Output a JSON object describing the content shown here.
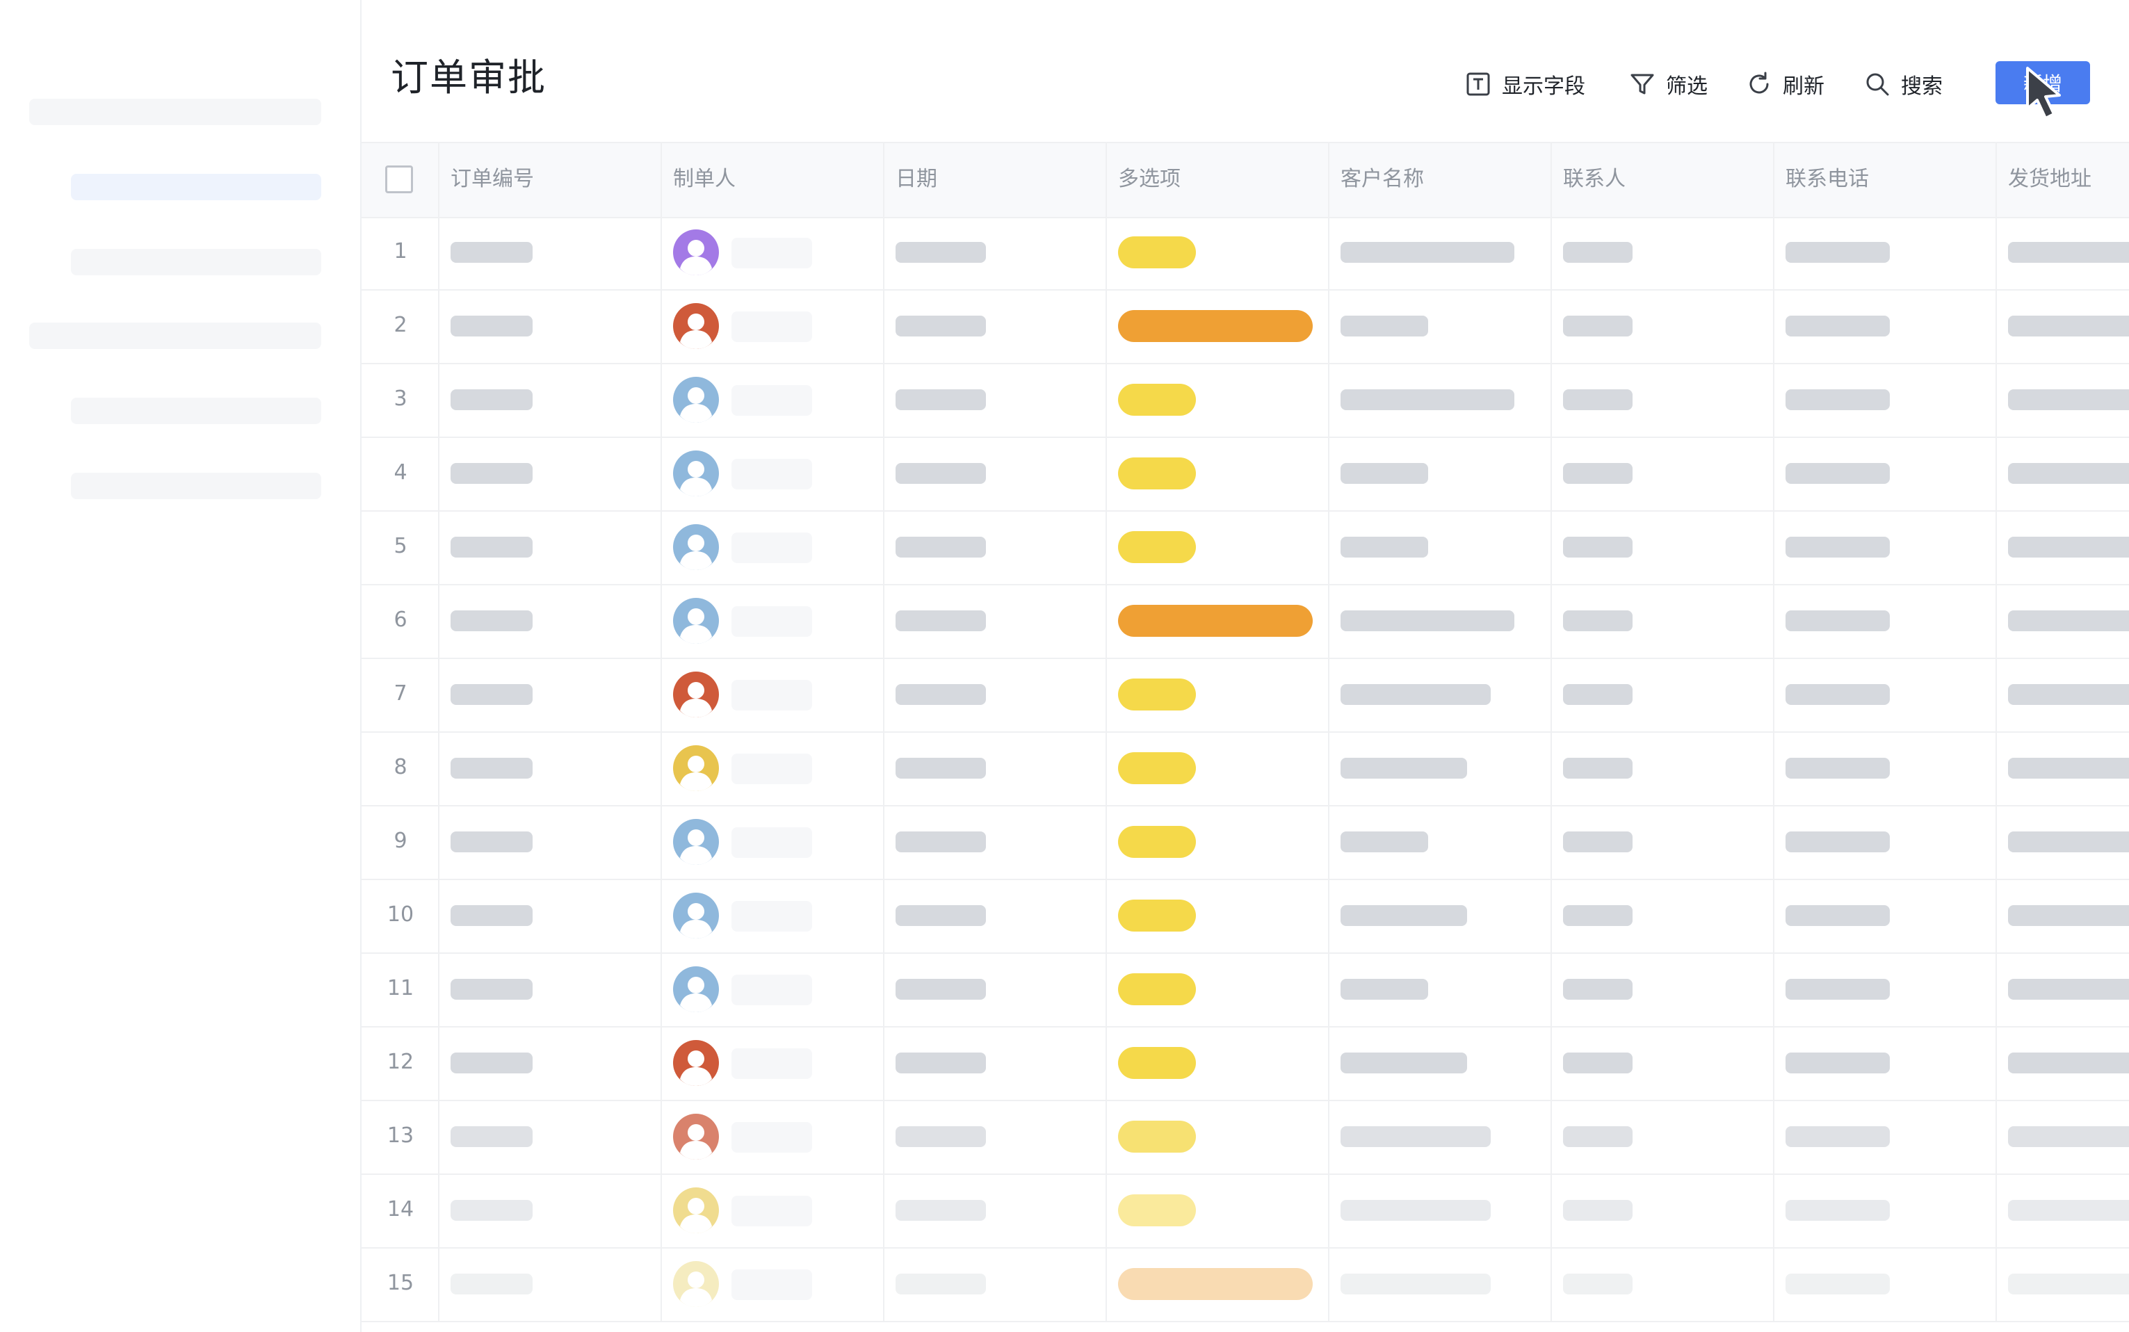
{
  "page": {
    "title": "订单审批"
  },
  "toolbar": {
    "show_fields": "显示字段",
    "filter": "筛选",
    "refresh": "刷新",
    "search": "搜索",
    "add": "新增"
  },
  "table": {
    "columns": [
      "订单编号",
      "制单人",
      "日期",
      "多选项",
      "客户名称",
      "联系人",
      "联系电话",
      "发货地址"
    ],
    "rows": [
      {
        "num": "1",
        "avatar_color": "#a37ae6",
        "tag": "short",
        "customer": "long"
      },
      {
        "num": "2",
        "avatar_color": "#cf5a3a",
        "tag": "long",
        "customer": "short"
      },
      {
        "num": "3",
        "avatar_color": "#8fb8dc",
        "tag": "short",
        "customer": "long"
      },
      {
        "num": "4",
        "avatar_color": "#8fb8dc",
        "tag": "short",
        "customer": "short"
      },
      {
        "num": "5",
        "avatar_color": "#8fb8dc",
        "tag": "short",
        "customer": "short"
      },
      {
        "num": "6",
        "avatar_color": "#8fb8dc",
        "tag": "long",
        "customer": "long"
      },
      {
        "num": "7",
        "avatar_color": "#cf5a3a",
        "tag": "short",
        "customer": "medium"
      },
      {
        "num": "8",
        "avatar_color": "#e8c44e",
        "tag": "short",
        "customer": "medium-short"
      },
      {
        "num": "9",
        "avatar_color": "#8fb8dc",
        "tag": "short",
        "customer": "short"
      },
      {
        "num": "10",
        "avatar_color": "#8fb8dc",
        "tag": "short",
        "customer": "medium-short"
      },
      {
        "num": "11",
        "avatar_color": "#8fb8dc",
        "tag": "short",
        "customer": "short"
      },
      {
        "num": "12",
        "avatar_color": "#cf5a3a",
        "tag": "short",
        "customer": "medium-short"
      },
      {
        "num": "13",
        "avatar_color": "#d9826c",
        "tag": "short",
        "customer": "medium"
      },
      {
        "num": "14",
        "avatar_color": "#f0dc8f",
        "tag": "short",
        "customer": "medium"
      },
      {
        "num": "15",
        "avatar_color": "#f5ecc0",
        "tag": "long",
        "customer": "medium"
      }
    ]
  },
  "colors": {
    "accent": "#4a7cf0",
    "tag_yellow": "#f5d94a",
    "tag_orange": "#efa034",
    "placeholder": "#d6d9de"
  },
  "icons": {
    "show_fields": "text-box-icon",
    "filter": "funnel-icon",
    "refresh": "refresh-icon",
    "search": "magnifier-icon",
    "cursor": "mouse-pointer-icon"
  }
}
